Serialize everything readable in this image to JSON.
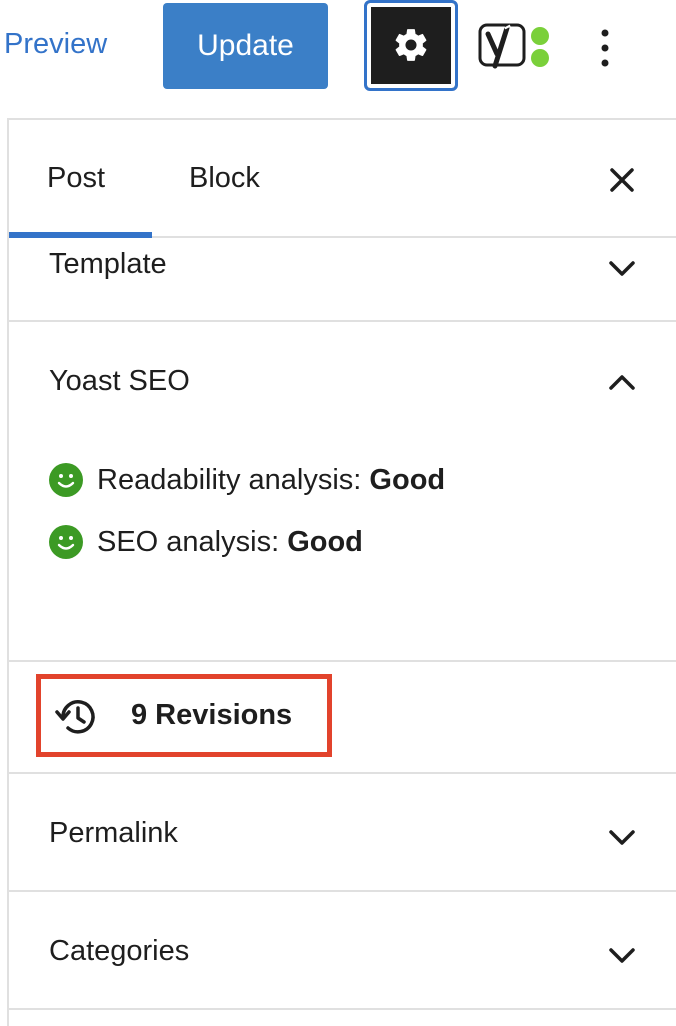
{
  "toolbar": {
    "preview_label": "Preview",
    "update_label": "Update",
    "settings_icon": "gear-icon",
    "yoast_icon": "yoast-logo-icon",
    "more_icon": "vertical-ellipsis-icon"
  },
  "sidebar": {
    "tabs": [
      {
        "label": "Post",
        "active": true
      },
      {
        "label": "Block",
        "active": false
      }
    ],
    "close_icon": "close-icon",
    "sections": {
      "template": {
        "title": "Template",
        "expanded": false
      },
      "yoast": {
        "title": "Yoast SEO",
        "expanded": true,
        "readability": {
          "label": "Readability analysis: ",
          "value": "Good"
        },
        "seo": {
          "label": "SEO analysis: ",
          "value": "Good"
        }
      },
      "revisions": {
        "label": "9 Revisions",
        "icon": "history-icon"
      },
      "permalink": {
        "title": "Permalink",
        "expanded": false
      },
      "categories": {
        "title": "Categories",
        "expanded": false
      }
    }
  },
  "colors": {
    "accent": "#3373c9",
    "update_button": "#3b7fc7",
    "good_status": "#3c9a24",
    "highlight_box": "#e2432c",
    "yoast_green": "#7ad03a"
  }
}
